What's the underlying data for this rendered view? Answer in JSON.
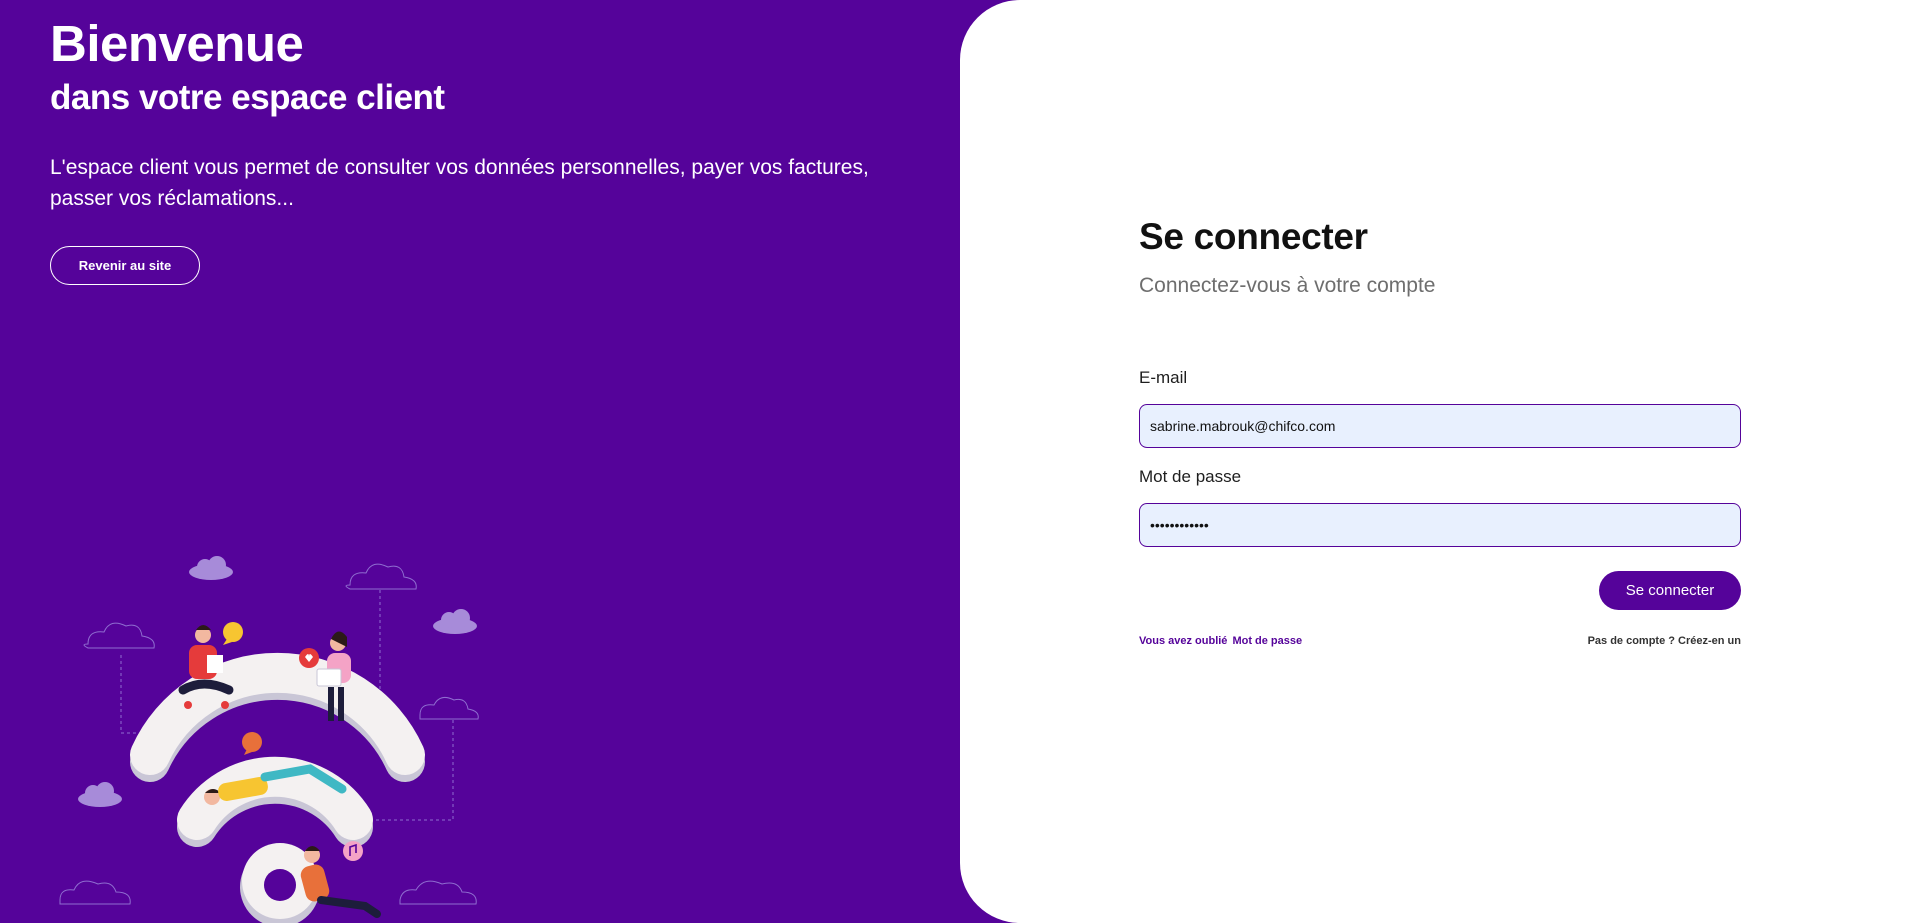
{
  "hero": {
    "title": "Bienvenue",
    "subtitle": "dans votre espace client",
    "description": "L'espace client vous permet de consulter vos données personnelles, payer vos factures, passer vos réclamations...",
    "back_button": "Revenir au site"
  },
  "login": {
    "title": "Se connecter",
    "subtitle": "Connectez-vous à votre compte",
    "email_label": "E-mail",
    "email_value": "sabrine.mabrouk@chifco.com",
    "password_label": "Mot de passe",
    "password_value": "••••••••••••",
    "submit_label": "Se connecter",
    "forgot_part1": "Vous avez oublié",
    "forgot_part2": "Mot de passe",
    "signup_label": "Pas de compte ? Créez-en un"
  },
  "colors": {
    "brand": "#55039a",
    "input_bg": "#e8f0fe",
    "panel_bg": "#ffffff"
  },
  "icons": [
    "wifi-illustration",
    "cloud-icon",
    "chat-bubble-icon",
    "heart-icon",
    "music-note-icon"
  ]
}
